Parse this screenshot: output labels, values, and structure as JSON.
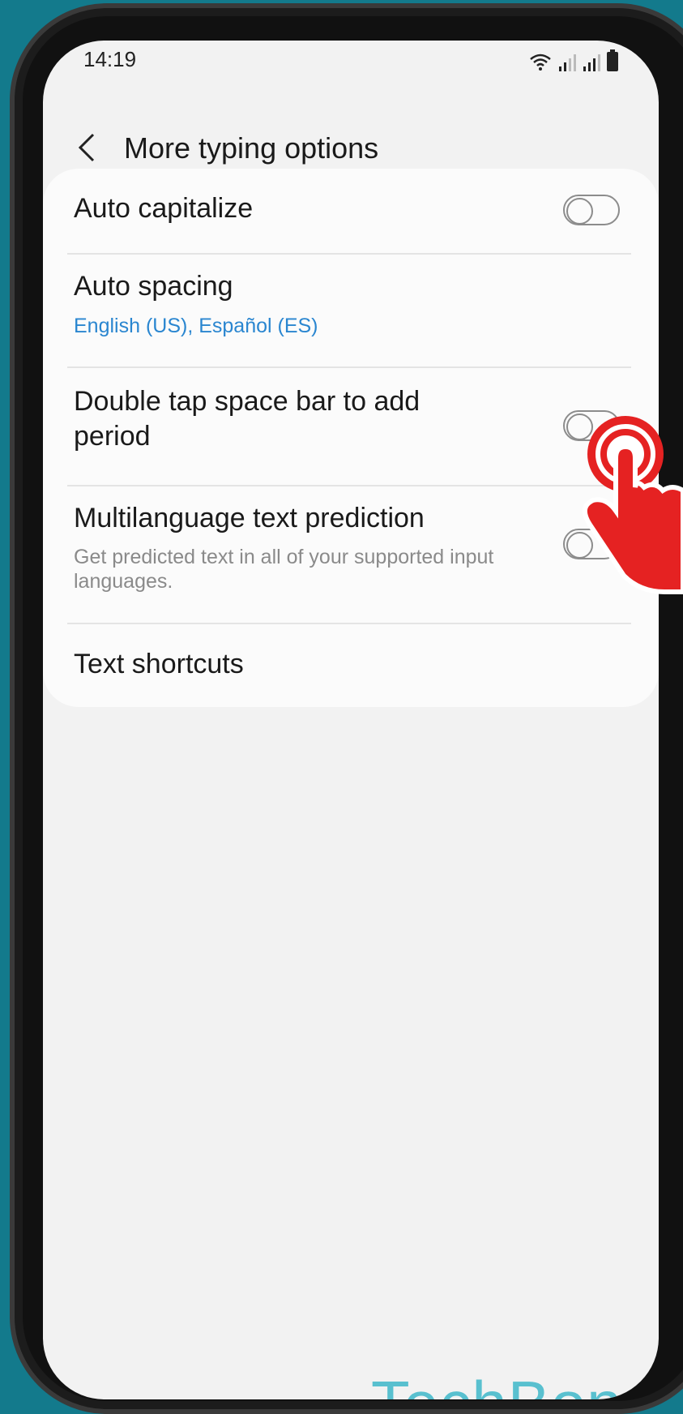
{
  "status_bar": {
    "time": "14:19",
    "icons": [
      "wifi-icon",
      "signal-icon",
      "signal-icon",
      "battery-icon"
    ]
  },
  "header": {
    "back_icon": "chevron-left-icon",
    "title": "More typing options"
  },
  "settings": {
    "auto_capitalize": {
      "title": "Auto capitalize",
      "enabled": false
    },
    "auto_spacing": {
      "title": "Auto spacing",
      "subtitle": "English (US), Español (ES)"
    },
    "double_tap": {
      "title_line1": "Double tap space bar to add",
      "title_line2": "period",
      "enabled": false
    },
    "multilanguage": {
      "title": "Multilanguage text prediction",
      "subtitle_line1": "Get predicted text in all of your supported input",
      "subtitle_line2": "languages.",
      "enabled": false
    },
    "text_shortcuts": {
      "title": "Text shortcuts"
    }
  },
  "colors": {
    "accent": "#2a86d0",
    "background": "#137a8c",
    "tap_indicator": "#e52222",
    "watermark": "#59c0cf"
  },
  "watermark": "TechBone"
}
